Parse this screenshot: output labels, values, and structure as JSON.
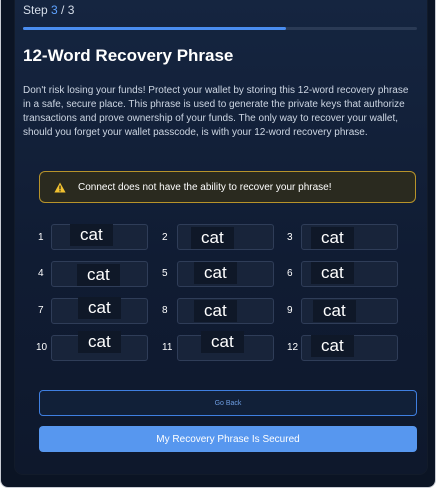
{
  "step": {
    "prefix": "Step ",
    "current": "3",
    "separator": " / ",
    "total": "3",
    "progress_fraction": 0.667
  },
  "title": "12-Word Recovery Phrase",
  "description": "Don't risk losing your funds! Protect your wallet by storing this 12-word recovery phrase in a safe, secure place. This phrase is used to generate the private keys that authorize transactions and prove ownership of your funds. The only way to recover your wallet, should you forget your wallet passcode, is with your 12-word recovery phrase.",
  "warning": {
    "icon": "warning-triangle-icon",
    "text": "Connect does not have the ability to recover your phrase!"
  },
  "words": [
    {
      "num": "1",
      "word": "cat"
    },
    {
      "num": "2",
      "word": "cat"
    },
    {
      "num": "3",
      "word": "cat"
    },
    {
      "num": "4",
      "word": "cat"
    },
    {
      "num": "5",
      "word": "cat"
    },
    {
      "num": "6",
      "word": "cat"
    },
    {
      "num": "7",
      "word": "cat"
    },
    {
      "num": "8",
      "word": "cat"
    },
    {
      "num": "9",
      "word": "cat"
    },
    {
      "num": "10",
      "word": "cat"
    },
    {
      "num": "11",
      "word": "cat"
    },
    {
      "num": "12",
      "word": "cat"
    }
  ],
  "buttons": {
    "back": "Go Back",
    "secured": "My Recovery Phrase Is Secured"
  },
  "colors": {
    "accent": "#5797ef",
    "warning_border": "#b7932a",
    "warning_icon": "#f2c230",
    "background": "#101c33"
  }
}
